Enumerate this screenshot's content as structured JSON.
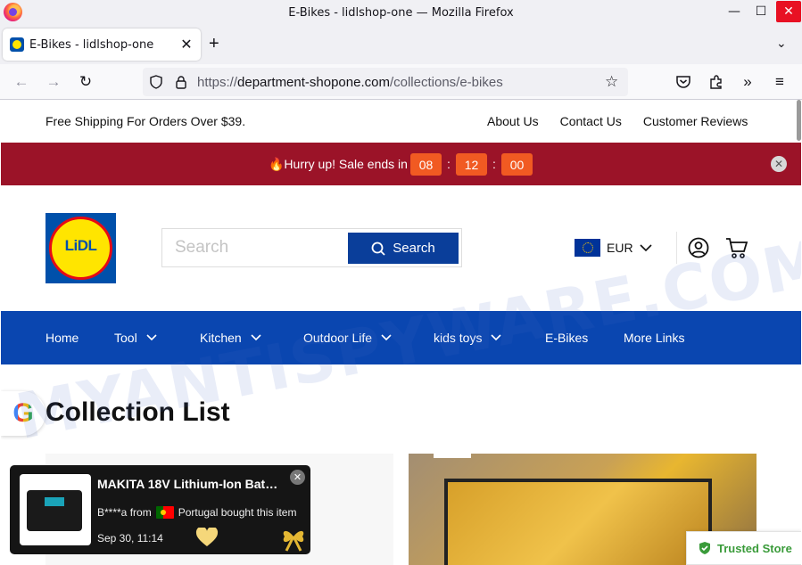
{
  "window": {
    "title": "E-Bikes - lidlshop-one — Mozilla Firefox"
  },
  "tab": {
    "title": "E-Bikes - lidlshop-one"
  },
  "urlbar": {
    "scheme": "https://",
    "host": "department-shopone.com",
    "path": "/collections/e-bikes"
  },
  "topbar": {
    "shipping": "Free Shipping For Orders Over $39.",
    "links": [
      "About Us",
      "Contact Us",
      "Customer Reviews"
    ]
  },
  "sale": {
    "text": "🔥Hurry up! Sale ends in",
    "hours": "08",
    "minutes": "12",
    "seconds": "00"
  },
  "header": {
    "logo_text": "LiDL",
    "search_placeholder": "Search",
    "search_button": "Search",
    "currency": "EUR"
  },
  "nav": {
    "items": [
      "Home",
      "Tool",
      "Kitchen",
      "Outdoor Life",
      "kids toys",
      "E-Bikes",
      "More Links"
    ]
  },
  "content": {
    "title": "Collection List",
    "google_letter": "G"
  },
  "popup": {
    "product": "MAKITA 18V Lithium-Ion Bat…",
    "buyer": "B****a from",
    "country_text": "Portugal bought this item",
    "time": "Sep 30, 11:14"
  },
  "trusted": {
    "label": "Trusted Store"
  },
  "watermark": "MYANTISPYWARE.COM",
  "colors": {
    "sale_bar": "#9b1328",
    "nav_bar": "#0a46b0",
    "search_button": "#0a3e9a",
    "timer_box": "#f15a22",
    "trusted_green": "#3a9b3a"
  }
}
